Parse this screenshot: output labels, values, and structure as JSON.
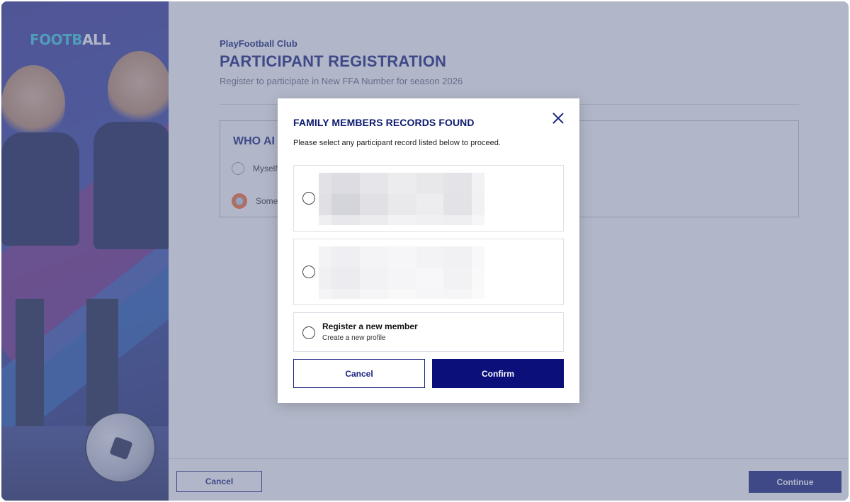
{
  "brand": {
    "logo_part1": "FOOTB",
    "logo_part2": "ALL"
  },
  "header": {
    "club_name": "PlayFootball Club",
    "page_title": "PARTICIPANT REGISTRATION",
    "subtitle": "Register to participate in New FFA Number for season 2026"
  },
  "who": {
    "title": "WHO AI",
    "options": [
      {
        "label": "Myself",
        "selected": false
      },
      {
        "label": "Someb",
        "selected": true
      }
    ]
  },
  "footer": {
    "cancel_label": "Cancel",
    "continue_label": "Continue"
  },
  "modal": {
    "title": "FAMILY MEMBERS RECORDS FOUND",
    "description": "Please select any participant record listed below to proceed.",
    "records": [
      {
        "content": "",
        "redacted": true
      },
      {
        "content": "",
        "redacted": true
      }
    ],
    "new_member": {
      "title": "Register a new member",
      "subtitle": "Create a new profile"
    },
    "cancel_label": "Cancel",
    "confirm_label": "Confirm"
  },
  "colors": {
    "primary": "#1a237e",
    "confirm": "#0a0f7a",
    "accent": "#ff6a2a",
    "logo_cyan": "#3ec6e0"
  }
}
